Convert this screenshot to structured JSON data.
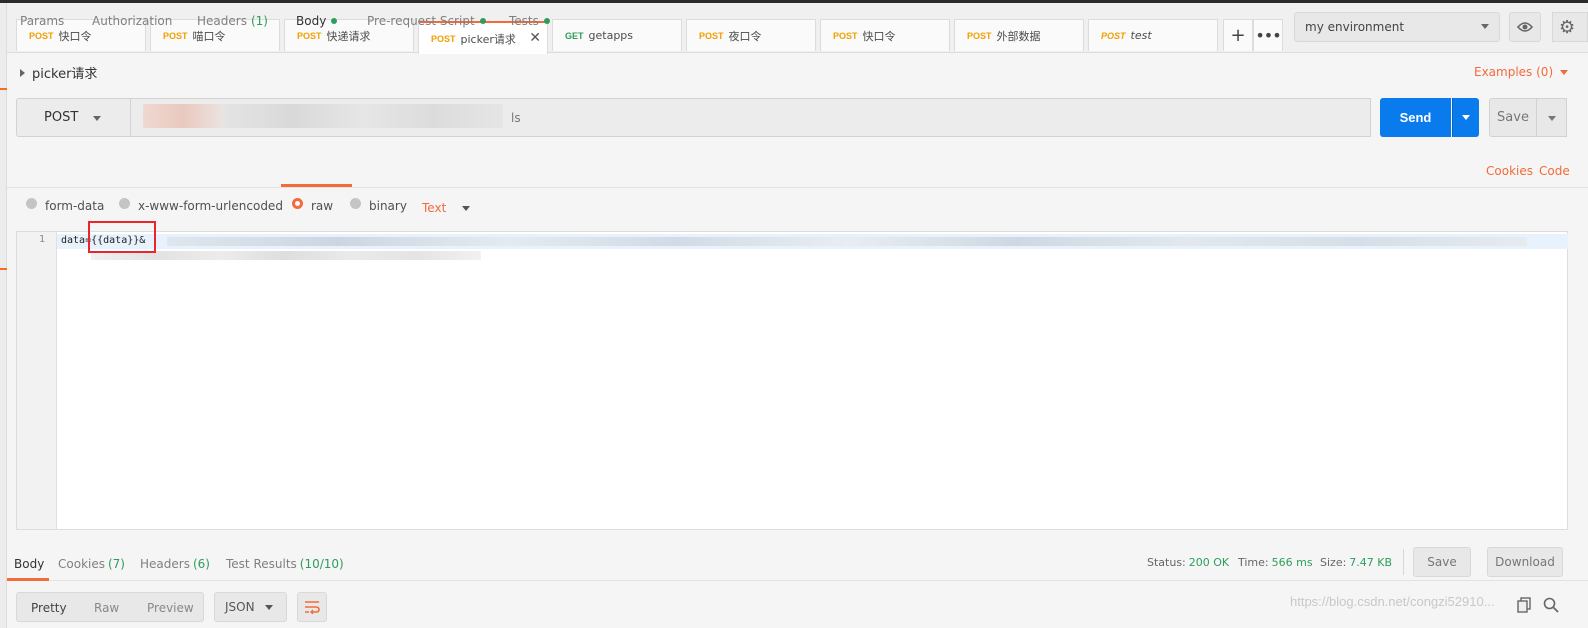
{
  "tabs": [
    {
      "method": "POST",
      "name": "快口令"
    },
    {
      "method": "POST",
      "name": "喵口令"
    },
    {
      "method": "POST",
      "name": "快递请求"
    },
    {
      "method": "POST",
      "name": "picker请求"
    },
    {
      "method": "GET",
      "name": "getapps"
    },
    {
      "method": "POST",
      "name": "夜口令"
    },
    {
      "method": "POST",
      "name": "快口令"
    },
    {
      "method": "POST",
      "name": "外部数据"
    },
    {
      "method": "POST",
      "name": "test"
    }
  ],
  "environment": {
    "selected": "my environment"
  },
  "request": {
    "name": "picker请求",
    "examples_label": "Examples (0)",
    "method": "POST",
    "url_visible_tail": "ls",
    "send_label": "Send",
    "save_label": "Save"
  },
  "subtabs": {
    "params": "Params",
    "authorization": "Authorization",
    "headers": "Headers",
    "headers_count": "(1)",
    "body": "Body",
    "prerequest": "Pre-request Script",
    "tests": "Tests",
    "cookies": "Cookies",
    "code": "Code"
  },
  "body_types": {
    "form_data": "form-data",
    "urlencoded": "x-www-form-urlencoded",
    "raw": "raw",
    "binary": "binary",
    "selected_format": "Text"
  },
  "editor": {
    "line_number": "1",
    "line1": "data={{data}}&"
  },
  "response": {
    "tabs": {
      "body": "Body",
      "cookies": "Cookies",
      "cookies_count": "(7)",
      "headers": "Headers",
      "headers_count": "(6)",
      "tests": "Test Results",
      "tests_count": "(10/10)"
    },
    "status_label": "Status:",
    "status_value": "200 OK",
    "time_label": "Time:",
    "time_value": "566 ms",
    "size_label": "Size:",
    "size_value": "7.47 KB",
    "save_label": "Save",
    "download_label": "Download",
    "views": {
      "pretty": "Pretty",
      "raw": "Raw",
      "preview": "Preview"
    },
    "format": "JSON"
  },
  "watermark": "https://blog.csdn.net/congzi52910...",
  "colors": {
    "accent": "#f26b3a",
    "send": "#097bed",
    "success": "#2e9d5c",
    "post": "#f0a000",
    "get": "#2e9d5c"
  }
}
